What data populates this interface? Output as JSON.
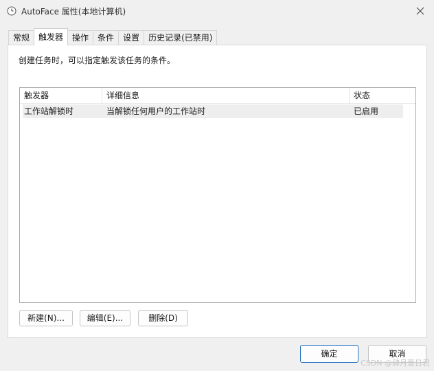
{
  "window": {
    "title": "AutoFace 属性(本地计算机)",
    "icon": "clock-icon"
  },
  "tabs": [
    {
      "label": "常规",
      "active": false
    },
    {
      "label": "触发器",
      "active": true
    },
    {
      "label": "操作",
      "active": false
    },
    {
      "label": "条件",
      "active": false
    },
    {
      "label": "设置",
      "active": false
    },
    {
      "label": "历史记录(已禁用)",
      "active": false
    }
  ],
  "triggers": {
    "description": "创建任务时，可以指定触发该任务的条件。",
    "columns": [
      "触发器",
      "详细信息",
      "状态"
    ],
    "rows": [
      {
        "trigger": "工作站解锁时",
        "details": "当解锁任何用户的工作站时",
        "status": "已启用"
      }
    ],
    "buttons": {
      "new": "新建(N)...",
      "edit": "编辑(E)...",
      "delete": "删除(D)"
    }
  },
  "footer": {
    "ok": "确定",
    "cancel": "取消"
  },
  "watermark": "CSDN @肆月壹日君"
}
